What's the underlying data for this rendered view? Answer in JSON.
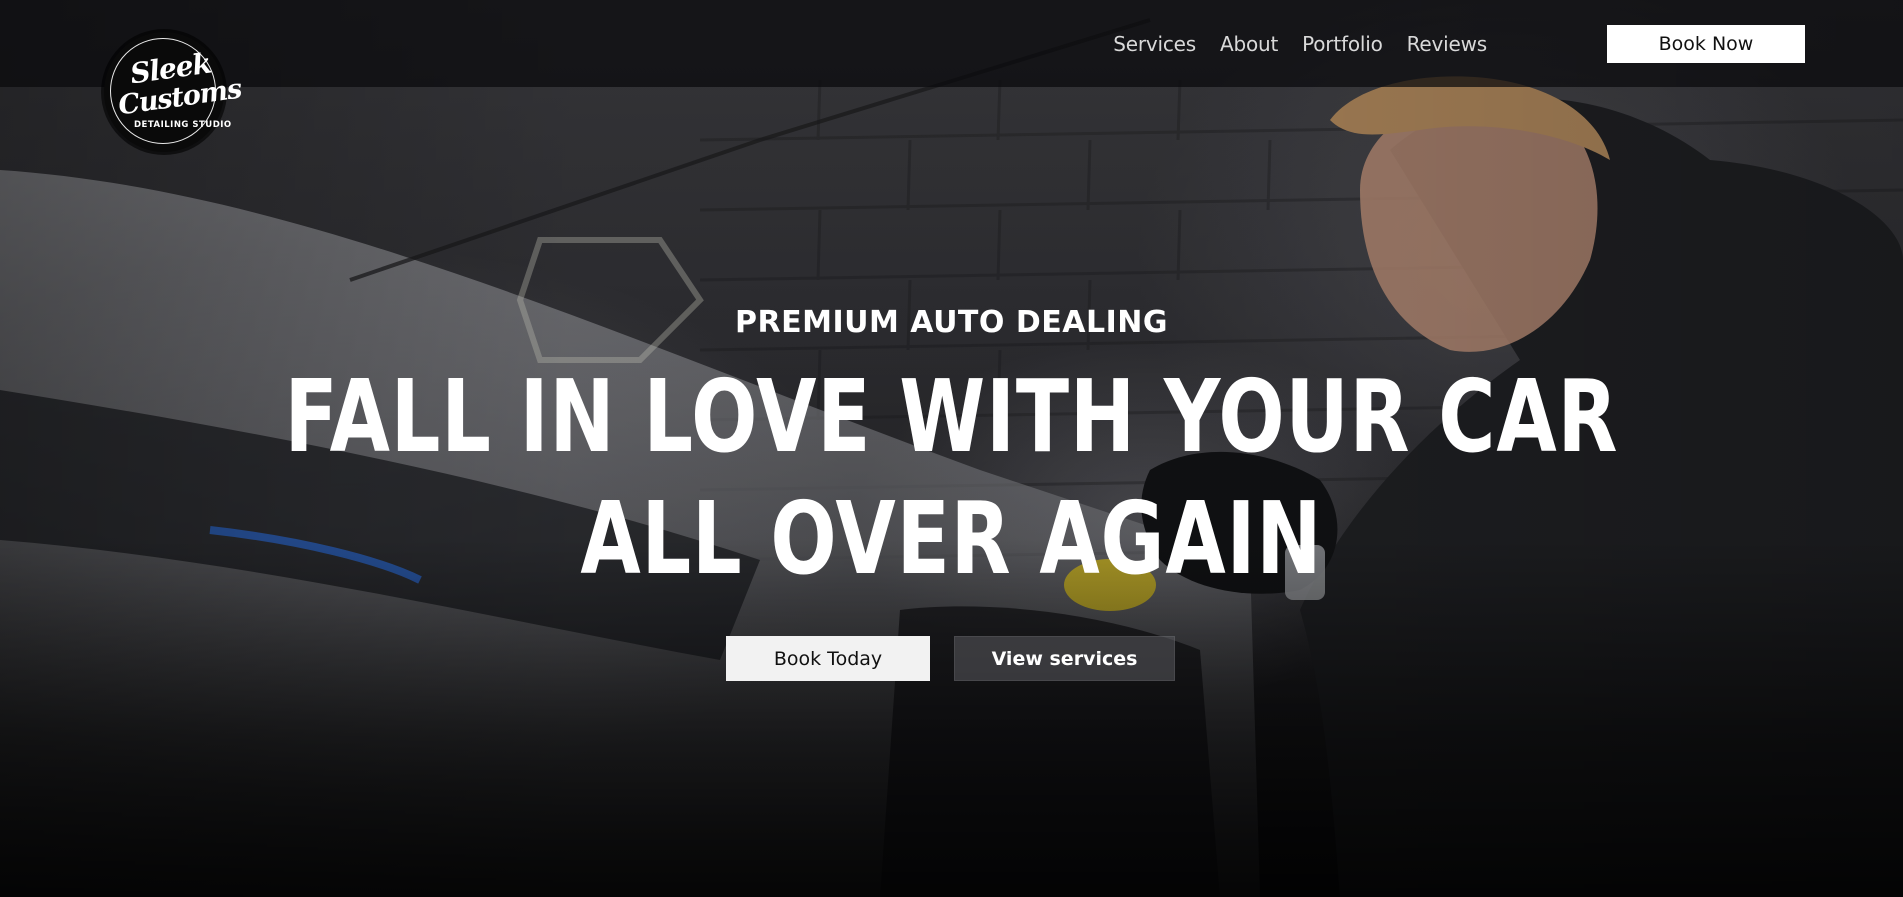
{
  "brand": {
    "logo_line1": "Sleek",
    "logo_line2": "Customs",
    "logo_sub": "DETAILING STUDIO"
  },
  "nav": {
    "items": [
      {
        "label": "Services"
      },
      {
        "label": "About"
      },
      {
        "label": "Portfolio"
      },
      {
        "label": "Reviews"
      }
    ],
    "cta_label": "Book Now"
  },
  "hero": {
    "eyebrow": "PREMIUM AUTO DEALING",
    "headline_line1": "FALL IN LOVE WITH YOUR CAR",
    "headline_line2": "ALL OVER AGAIN",
    "primary_button": "Book Today",
    "secondary_button": "View services"
  },
  "colors": {
    "primary_button_bg": "#f2f2f2",
    "secondary_button_bg": "#5a5a5e",
    "topbar_bg": "#0a0a0c",
    "text": "#ffffff"
  }
}
